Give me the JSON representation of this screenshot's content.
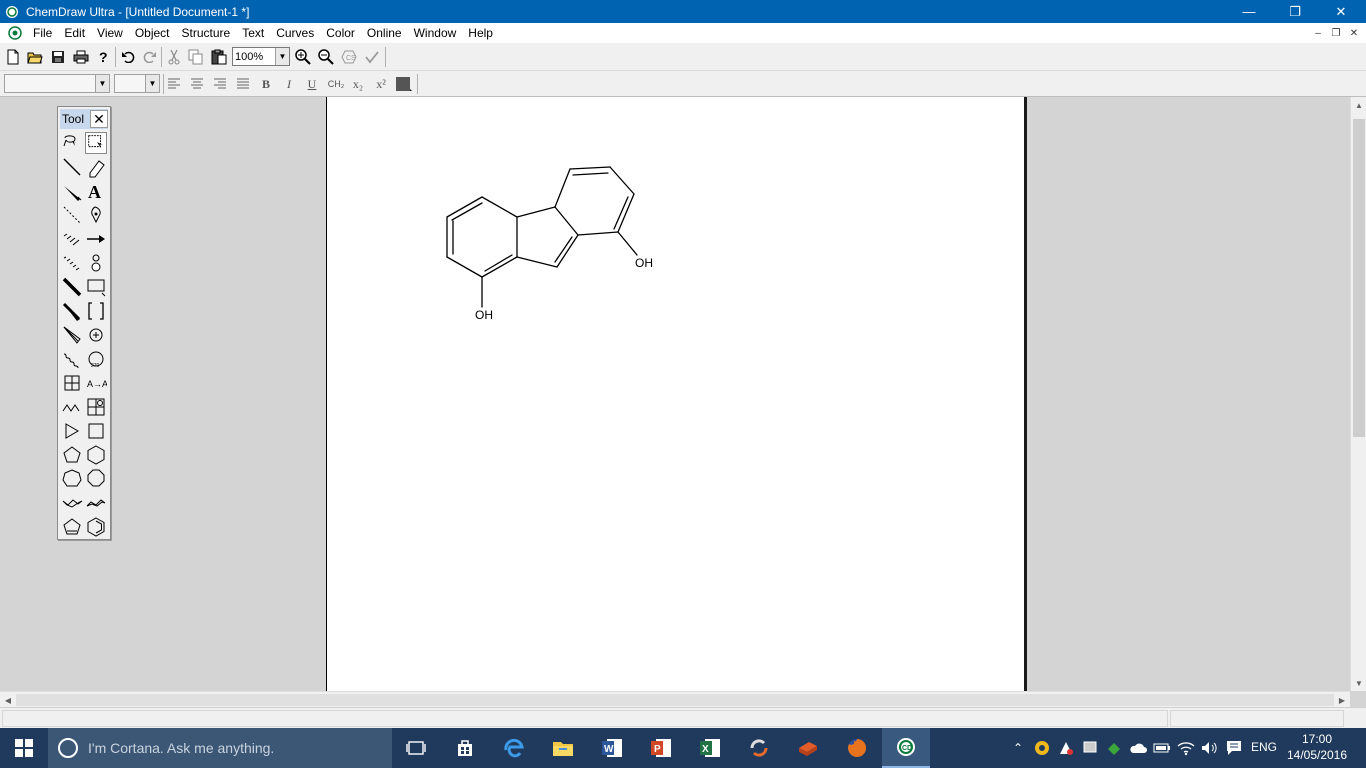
{
  "window": {
    "title": "ChemDraw Ultra - [Untitled Document-1 *]",
    "minimize_glyph": "—",
    "restore_glyph": "❐",
    "close_glyph": "✕"
  },
  "menu": {
    "items": [
      "File",
      "Edit",
      "View",
      "Object",
      "Structure",
      "Text",
      "Curves",
      "Color",
      "Online",
      "Window",
      "Help"
    ],
    "mdi_minimize": "–",
    "mdi_restore": "❐",
    "mdi_close": "✕"
  },
  "toolbar": {
    "zoom_value": "100%"
  },
  "format_toolbar": {
    "ch2_label": "CH₂",
    "subscript_label": "x₂",
    "superscript_label": "x²",
    "bold_label": "B",
    "italic_label": "I",
    "underline_label": "U"
  },
  "palette": {
    "title": "Tool",
    "close_glyph": "✕",
    "tools": [
      "lasso-tool",
      "marquee-tool",
      "bond-tool",
      "eraser-tool",
      "wedge-bond-tool",
      "text-tool",
      "dashed-bond-tool",
      "pen-tool",
      "hashed-wedge-tool",
      "arrow-tool",
      "hashed-bond-tool",
      "orbital-tool",
      "bold-bond-tool",
      "drawing-elements-tool",
      "bold-wedge-tool",
      "bracket-tool",
      "wedged-hash-tool",
      "chemical-symbols-tool",
      "wavy-bond-tool",
      "query-tool",
      "table-tool",
      "mass-fragmentation-tool",
      "chain-tool",
      "template-tool",
      "cyclopropane-tool",
      "cyclobutane-tool",
      "cyclopentane-tool",
      "cyclohexane-tool",
      "cycloheptane-tool",
      "cyclooctane-tool",
      "cyclohexane-chair-tool-1",
      "cyclohexane-chair-tool-2",
      "cyclopentadiene-tool",
      "benzene-tool"
    ]
  },
  "molecule": {
    "labels": [
      "OH",
      "OH"
    ]
  },
  "taskbar": {
    "cortana_text": "I'm Cortana. Ask me anything.",
    "language": "ENG",
    "time": "17:00",
    "date": "14/05/2016"
  },
  "colors": {
    "titlebar": "#0063b1",
    "taskbar": "#1f3a5c",
    "cortana_box": "#3c5675",
    "canvas": "#ffffff",
    "workspace": "#d4d4d4"
  }
}
